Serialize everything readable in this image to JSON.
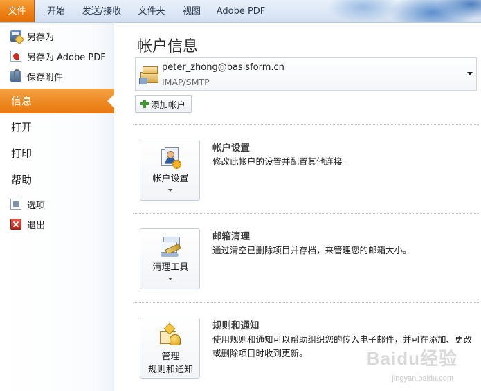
{
  "ribbon": {
    "tabs": [
      {
        "label": "文件",
        "active": true
      },
      {
        "label": "开始"
      },
      {
        "label": "发送/接收"
      },
      {
        "label": "文件夹"
      },
      {
        "label": "视图"
      },
      {
        "label": "Adobe PDF"
      }
    ]
  },
  "nav": {
    "commands_top": [
      {
        "label": "另存为",
        "icon": "save-as-icon"
      },
      {
        "label": "另存为 Adobe PDF",
        "icon": "pdf-icon"
      },
      {
        "label": "保存附件",
        "icon": "attachment-icon"
      }
    ],
    "pages": [
      {
        "label": "信息",
        "active": true
      },
      {
        "label": "打开"
      },
      {
        "label": "打印"
      },
      {
        "label": "帮助"
      }
    ],
    "commands_bottom": [
      {
        "label": "选项",
        "icon": "options-icon"
      },
      {
        "label": "退出",
        "icon": "exit-icon"
      }
    ]
  },
  "main": {
    "title": "帐户信息",
    "account": {
      "email": "peter_zhong@basisform.cn",
      "type": "IMAP/SMTP"
    },
    "add_account_label": "添加帐户",
    "sections": [
      {
        "button_label": "帐户设置",
        "title": "帐户设置",
        "description": "修改此帐户的设置并配置其他连接。",
        "icon": "account-settings-icon"
      },
      {
        "button_label": "清理工具",
        "title": "邮箱清理",
        "description": "通过清空已删除项目并存档，来管理您的邮箱大小。",
        "icon": "cleanup-tools-icon"
      },
      {
        "button_label_line1": "管理",
        "button_label_line2": "规则和通知",
        "title": "规则和通知",
        "description": "使用规则和通知可以帮助组织您的传入电子邮件，并可在添加、更改或删除项目时收到更新。",
        "icon": "rules-alerts-icon"
      }
    ]
  },
  "watermark": {
    "text": "Baidu经验",
    "url_text": "jingyan.baidu.com"
  },
  "colors": {
    "file_tab": "#ec7f14",
    "active_nav": "#ee8a24",
    "ribbon_bg": "#dce7f5"
  }
}
